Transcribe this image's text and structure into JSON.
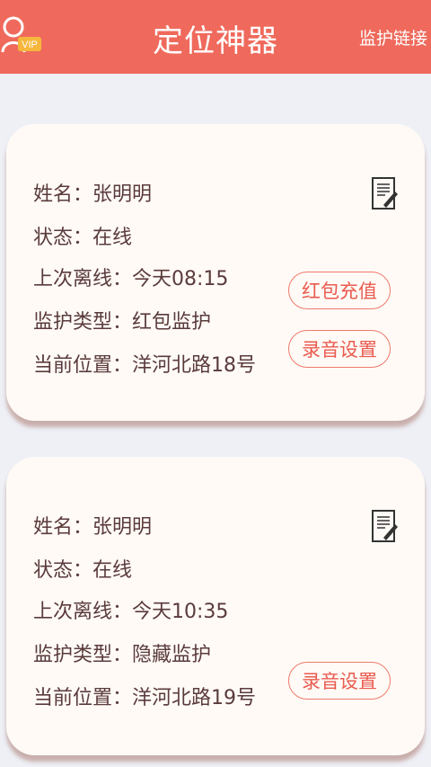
{
  "header": {
    "title": "定位神器",
    "link_label": "监护链接",
    "vip_badge": "VIP"
  },
  "cards": [
    {
      "name_label": "姓名：",
      "name": "张明明",
      "status_label": "状态：",
      "status": "在线",
      "last_offline_label": "上次离线：",
      "last_offline": "今天08:15",
      "type_label": "监护类型：",
      "type": "红包监护",
      "location_label": "当前位置：",
      "location": "洋河北路18号",
      "button_recharge": "红包充值",
      "button_audio": "录音设置"
    },
    {
      "name_label": "姓名：",
      "name": "张明明",
      "status_label": "状态：",
      "status": "在线",
      "last_offline_label": "上次离线：",
      "last_offline": "今天10:35",
      "type_label": "监护类型：",
      "type": "隐藏监护",
      "location_label": "当前位置：",
      "location": "洋河北路19号",
      "button_audio": "录音设置"
    }
  ],
  "colors": {
    "header": "#ef6a5c",
    "accent": "#ea5b4e",
    "background": "#eef0f6",
    "card": "#fffaf6"
  }
}
